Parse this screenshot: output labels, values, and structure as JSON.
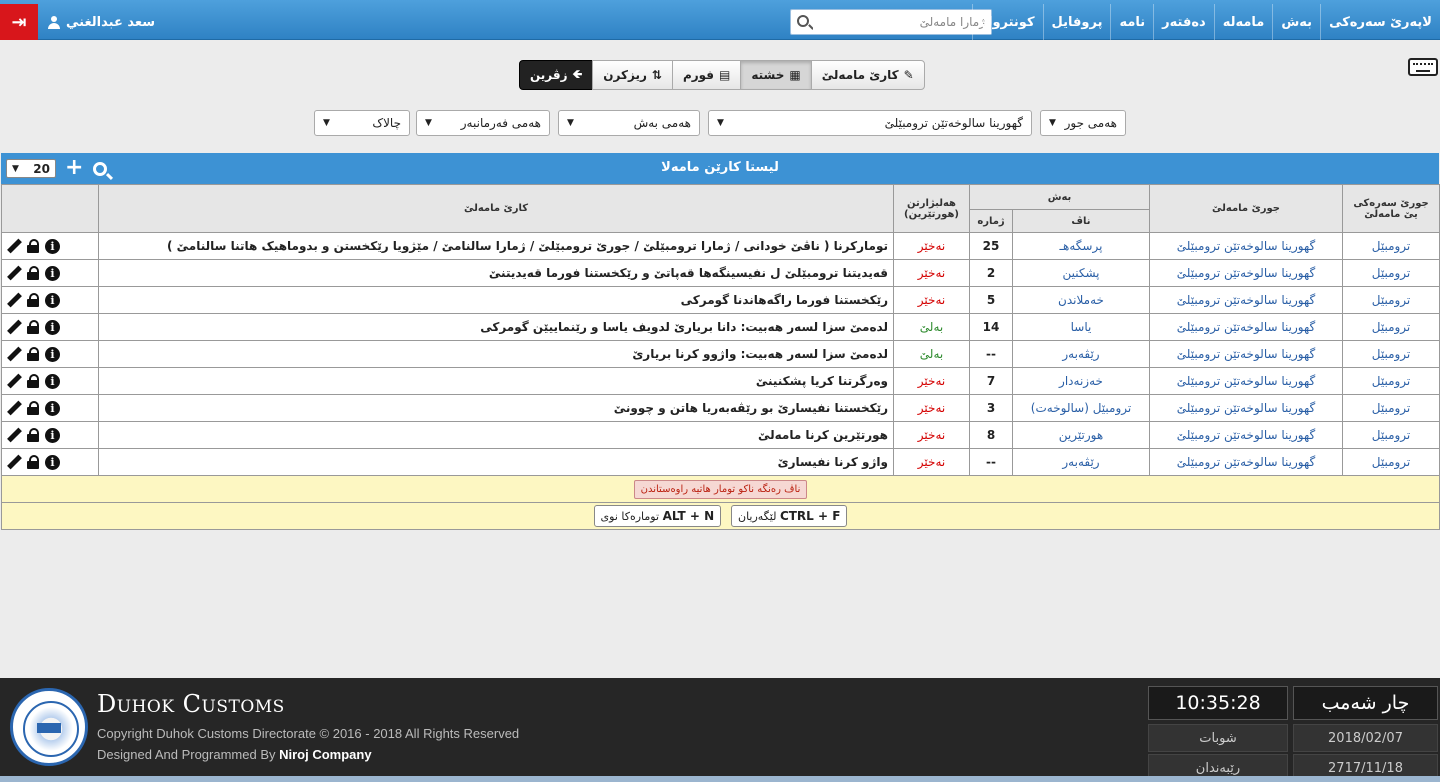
{
  "nav": {
    "user_name": "سعد عبدالغني",
    "search_placeholder": "ژمارا مامەلێ",
    "items": [
      "لاپەرێ سەرەکی",
      "بەش",
      "مامەلە",
      "دەفتەر",
      "نامە",
      "پروفایل",
      "کونترول"
    ]
  },
  "view": {
    "back_label": "زڤرین",
    "sort_label": "ریزکرن",
    "form_label": "فورم",
    "grid_label": "خشتە",
    "work_label": "کارێ مامەلێ"
  },
  "filters": {
    "type": "هەمی جور",
    "category": "گهورینا سالوخەتێن ترومبێلێ",
    "department": "هەمی بەش",
    "employee": "هەمی فەرمانبەر",
    "printer": "چالاک"
  },
  "panel": {
    "title": "لیستا کارێن مامەلا",
    "page_size": "20"
  },
  "table": {
    "headers": {
      "main_type": "جورێ سەرەکی یێ مامەلێ",
      "type": "جورێ مامەلێ",
      "section": "بەش",
      "section_name": "ناڤ",
      "section_number": "ژمارە",
      "archived": "هەلبژارتن (هورتێرین)",
      "work": "کارێ مامەلێ"
    },
    "rows": [
      {
        "main": "ترومبێل",
        "type": "گهورینا سالوخەتێن ترومبێلێ",
        "section": "پرسگەهـ",
        "number": "25",
        "status": "نەخێر",
        "desc": "تومارکرنا ( ناڤێ خودانی / ژمارا ترومبێلێ / جورێ ترومبێلێ / ژمارا سالنامێ / مێژویا رێکخستن و بدوماهیک هاتنا سالنامێ )"
      },
      {
        "main": "ترومبێل",
        "type": "گهورینا سالوخەتێن ترومبێلێ",
        "section": "پشکنین",
        "number": "2",
        "status": "نەخێر",
        "desc": "قەیدیتنا ترومبێلێ ل نفیسینگەها قەپاتێ و رێکخستنا فورما قەیدیتنێ"
      },
      {
        "main": "ترومبێل",
        "type": "گهورینا سالوخەتێن ترومبێلێ",
        "section": "خەملاندن",
        "number": "5",
        "status": "نەخێر",
        "desc": "رێکخستنا فورما راگەهاندنا گومرکی"
      },
      {
        "main": "ترومبێل",
        "type": "گهورینا سالوخەتێن ترومبێلێ",
        "section": "یاسا",
        "number": "14",
        "status": "بەلێ",
        "desc": "لدەمێ سزا لسەر هەبیت: دانا بریارێ لدویف یاسا و رێنماییێن گومرکی"
      },
      {
        "main": "ترومبێل",
        "type": "گهورینا سالوخەتێن ترومبێلێ",
        "section": "رێڤەبەر",
        "number": "--",
        "status": "بەلێ",
        "desc": "لدەمێ سزا لسەر هەبیت: واژوو کرنا بریارێ"
      },
      {
        "main": "ترومبێل",
        "type": "گهورینا سالوخەتێن ترومبێلێ",
        "section": "خەزنەدار",
        "number": "7",
        "status": "نەخێر",
        "desc": "وەرگرتنا کریا پشکنینێ"
      },
      {
        "main": "ترومبێل",
        "type": "گهورینا سالوخەتێن ترومبێلێ",
        "section": "ترومبێل (سالوخەت)",
        "number": "3",
        "status": "نەخێر",
        "desc": "رێکخستنا نفیسارێ بو رێڤەبەریا هاتن و چوونێ"
      },
      {
        "main": "ترومبێل",
        "type": "گهورینا سالوخەتێن ترومبێلێ",
        "section": "هورتێرین",
        "number": "8",
        "status": "نەخێر",
        "desc": "هورتێرین کرنا مامەلێ"
      },
      {
        "main": "ترومبێل",
        "type": "گهورینا سالوخەتێن ترومبێلێ",
        "section": "رێڤەبەر",
        "number": "--",
        "status": "نەخێر",
        "desc": "واژو کرنا نفیسارێ"
      }
    ],
    "note_text": "ناڤ رەنگە ناکو تومار هاتیە راوەستاندن",
    "shortcut_new_key": "ALT + N",
    "shortcut_new_label": "تومارەکا نوی",
    "shortcut_find_key": "CTRL + F",
    "shortcut_find_label": "لێگەریان"
  },
  "footer": {
    "brand": "Duhok Customs",
    "copyright": "Copyright Duhok Customs Directorate © 2016 - 2018 All Rights Reserved",
    "designed_prefix": "Designed And Programmed By",
    "designed_company": "Niroj Company",
    "day": "چار شەمب",
    "time": "10:35:28",
    "month_kurdish": "شوبات",
    "date_gregorian": "2018/02/07",
    "month_kurdish2": "رێبەندان",
    "date_kurdish": "2717/11/18"
  }
}
